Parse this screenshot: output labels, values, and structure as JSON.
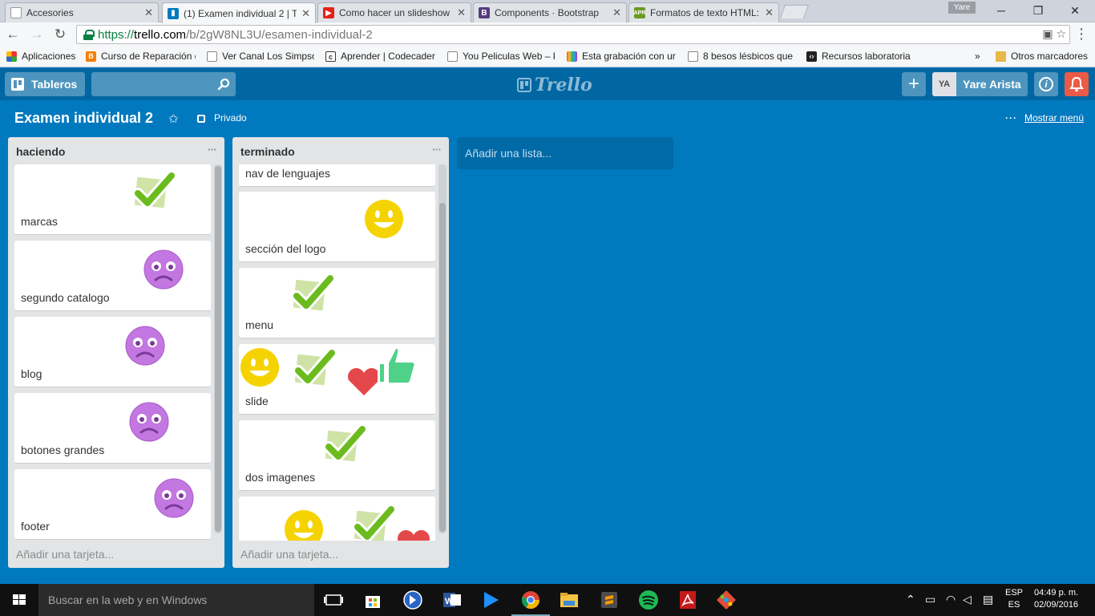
{
  "browser": {
    "tabs": [
      {
        "label": "Accesories",
        "favicon": "page-icon",
        "color": "#888888"
      },
      {
        "label": "(1) Examen individual 2 | T",
        "favicon": "trello-icon",
        "color": "#0079bf"
      },
      {
        "label": "Como hacer un slideshow",
        "favicon": "youtube-icon",
        "color": "#e62117"
      },
      {
        "label": "Components · Bootstrap",
        "favicon": "bootstrap-icon",
        "color": "#563d7c"
      },
      {
        "label": "Formatos de texto HTML:",
        "favicon": "apr-icon",
        "color": "#6a9a1f"
      }
    ],
    "profile": "Yare",
    "url": {
      "scheme": "https://",
      "host": "trello.com",
      "path": "/b/2gW8NL3U/esamen-individual-2"
    },
    "bookmarks": [
      {
        "label": "Aplicaciones",
        "icon": "apps-grid-icon"
      },
      {
        "label": "Curso de Reparación d",
        "icon": "blogger-icon"
      },
      {
        "label": "Ver Canal Los Simpsor",
        "icon": "page-icon"
      },
      {
        "label": "Aprender | Codecader",
        "icon": "codecademy-icon"
      },
      {
        "label": "You Peliculas Web – P",
        "icon": "page-icon"
      },
      {
        "label": "Esta grabación con ur",
        "icon": "bookmark-icon"
      },
      {
        "label": "8 besos lésbicos que c",
        "icon": "page-icon"
      },
      {
        "label": "Recursos laboratoria",
        "icon": "code-icon"
      }
    ],
    "more": "»",
    "other_bookmarks": "Otros marcadores"
  },
  "header": {
    "boards": "Tableros",
    "search_placeholder": "",
    "logo": "Trello",
    "add": "+",
    "avatar": "YA",
    "user": "Yare Arista",
    "info": "i"
  },
  "board": {
    "title": "Examen individual 2",
    "privacy": "Privado",
    "show_menu": "Mostrar menú",
    "add_list": "Añadir una lista..."
  },
  "lists": [
    {
      "title": "haciendo",
      "menu": "···",
      "add_card": "Añadir una tarjeta...",
      "cards": [
        {
          "label": "marcas",
          "stickers": [
            "check"
          ]
        },
        {
          "label": "segundo catalogo",
          "stickers": [
            "frown"
          ]
        },
        {
          "label": "blog",
          "stickers": [
            "frown"
          ]
        },
        {
          "label": "botones grandes",
          "stickers": [
            "frown"
          ]
        },
        {
          "label": "footer",
          "stickers": [
            "frown"
          ]
        }
      ]
    },
    {
      "title": "terminado",
      "menu": "···",
      "add_card": "Añadir una tarjeta...",
      "cards": [
        {
          "label": "nav de lenguajes",
          "stickers": []
        },
        {
          "label": "sección del logo",
          "stickers": [
            "smile"
          ]
        },
        {
          "label": "menu",
          "stickers": [
            "check"
          ]
        },
        {
          "label": "slide",
          "stickers": [
            "smile",
            "check",
            "heart",
            "thumbsup"
          ]
        },
        {
          "label": "dos imagenes",
          "stickers": [
            "check"
          ]
        },
        {
          "label": "",
          "stickers": [
            "smile",
            "check",
            "heart"
          ]
        }
      ]
    }
  ],
  "taskbar": {
    "search_placeholder": "Buscar en la web y en Windows",
    "lang_top": "ESP",
    "lang_bottom": "ES",
    "time": "04:49 p. m.",
    "date": "02/09/2016"
  },
  "colors": {
    "board_bg": "#0079bf",
    "header_bg": "#0067a3",
    "list_bg": "#e2e4e6",
    "notification": "#eb5a46"
  }
}
